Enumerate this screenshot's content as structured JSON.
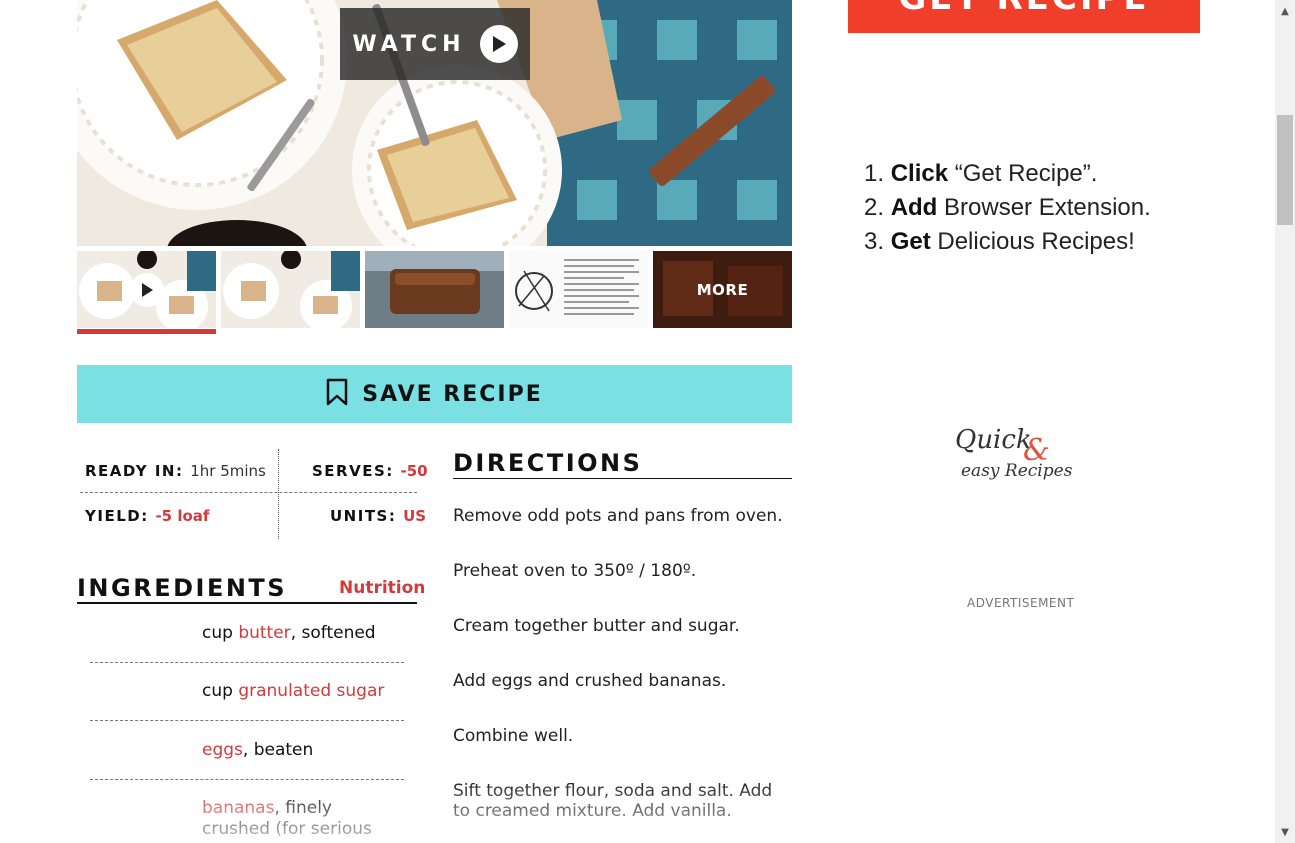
{
  "hero": {
    "watch_label": "WATCH"
  },
  "thumbs": {
    "more_label": "MORE"
  },
  "save": {
    "label": "SAVE RECIPE"
  },
  "info": {
    "ready_label": "READY IN:",
    "ready_value": "1hr 5mins",
    "serves_label": "SERVES:",
    "serves_value": "-50",
    "yield_label": "YIELD:",
    "yield_value": "-5 loaf",
    "units_label": "UNITS:",
    "units_value": "US"
  },
  "ingredients": {
    "title": "INGREDIENTS",
    "nutrition_label": "Nutrition",
    "items": [
      {
        "pre": "cup ",
        "link": "butter",
        "post": ", softened"
      },
      {
        "pre": "cup ",
        "link": "granulated sugar",
        "post": ""
      },
      {
        "pre": "",
        "link": "eggs",
        "post": ", beaten"
      },
      {
        "pre": "",
        "link": "bananas",
        "post": ", finely crushed (for serious"
      }
    ]
  },
  "directions": {
    "title": "DIRECTIONS",
    "steps": [
      "Remove odd pots and pans from oven.",
      "Preheat oven to 350º / 180º.",
      "Cream together butter and sugar.",
      "Add eggs and crushed bananas.",
      "Combine well.",
      "Sift together flour, soda and salt. Add to creamed mixture. Add vanilla."
    ]
  },
  "ad": {
    "button_label": "GET RECIPE",
    "steps": [
      {
        "num": "1.",
        "bold": "Click",
        "rest": " “Get Recipe”."
      },
      {
        "num": "2.",
        "bold": "Add",
        "rest": " Browser Extension."
      },
      {
        "num": "3.",
        "bold": "Get",
        "rest": " Delicious Recipes!"
      }
    ],
    "logo_line1": "Quick",
    "logo_amp": "&",
    "logo_line2": "easy Recipes",
    "label": "ADVERTISEMENT"
  },
  "colors": {
    "accent_red": "#d33a3a",
    "save_bg": "#7be0e3",
    "ad_red": "#ef3f2a"
  },
  "icons": {
    "watch": "play-icon",
    "save": "bookmark-icon",
    "scroll_up": "arrow-up-icon",
    "scroll_down": "arrow-down-icon"
  }
}
